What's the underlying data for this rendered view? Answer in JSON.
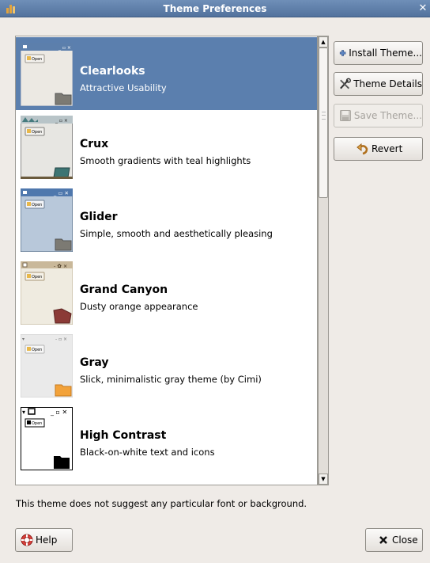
{
  "window": {
    "title": "Theme Preferences"
  },
  "themes": [
    {
      "name": "Clearlooks",
      "description": "Attractive Usability",
      "selected": true,
      "preview_button": "Open"
    },
    {
      "name": "Crux",
      "description": "Smooth gradients with teal highlights",
      "selected": false,
      "preview_button": "Open"
    },
    {
      "name": "Glider",
      "description": "Simple, smooth and aesthetically pleasing",
      "selected": false,
      "preview_button": "Open"
    },
    {
      "name": "Grand Canyon",
      "description": "Dusty orange appearance",
      "selected": false,
      "preview_button": "Open"
    },
    {
      "name": "Gray",
      "description": "Slick, minimalistic gray theme (by Cimi)",
      "selected": false,
      "preview_button": "Open"
    },
    {
      "name": "High Contrast",
      "description": "Black-on-white text and icons",
      "selected": false,
      "preview_button": "Open"
    }
  ],
  "buttons": {
    "install": "Install Theme...",
    "details": "Theme Details",
    "save": "Save Theme...",
    "revert": "Revert",
    "help": "Help",
    "close": "Close"
  },
  "status": "This theme does not suggest any particular font or background.",
  "icons": {
    "app": "app-icon",
    "close": "close-icon",
    "install": "plus-icon",
    "details": "tools-icon",
    "save": "floppy-icon",
    "revert": "revert-arrow-icon",
    "help": "lifebuoy-icon",
    "close_button": "x-icon"
  },
  "colors": {
    "titlebar": "#5d7ea8",
    "selection": "#5b7fae",
    "window_bg": "#efebe7"
  }
}
